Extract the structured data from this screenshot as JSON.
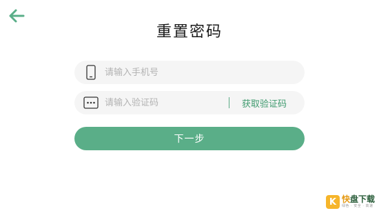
{
  "header": {
    "title": "重置密码",
    "back_icon": "arrow-left-icon"
  },
  "form": {
    "phone": {
      "placeholder": "请输入手机号",
      "value": "",
      "icon": "phone-icon"
    },
    "code": {
      "placeholder": "请输入验证码",
      "value": "",
      "icon": "code-dots-icon",
      "get_code_label": "获取验证码"
    },
    "next_label": "下一步"
  },
  "watermark": {
    "brand_first": "快",
    "brand_rest": "盘下载",
    "tagline": "绿色 · 安全 · 高速"
  },
  "colors": {
    "accent": "#5aae88",
    "link": "#3f9a6e",
    "field_bg": "#f5f5f5"
  }
}
